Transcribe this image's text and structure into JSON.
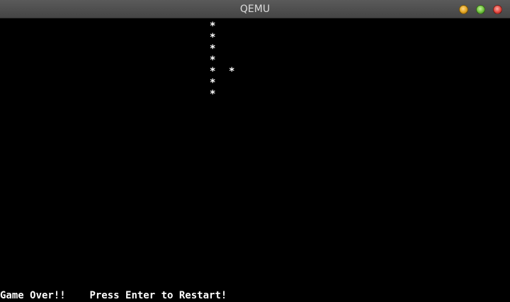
{
  "window": {
    "title": "QEMU"
  },
  "screen": {
    "snake": [
      "*",
      "*",
      "*",
      "*",
      "*",
      "*",
      "*"
    ],
    "food": "*",
    "game_over": "Game Over!!",
    "restart_prompt": "Press Enter to Restart!"
  },
  "colors": {
    "background": "#000000",
    "text": "#ffffff",
    "titlebar": "#4a4a4a"
  }
}
